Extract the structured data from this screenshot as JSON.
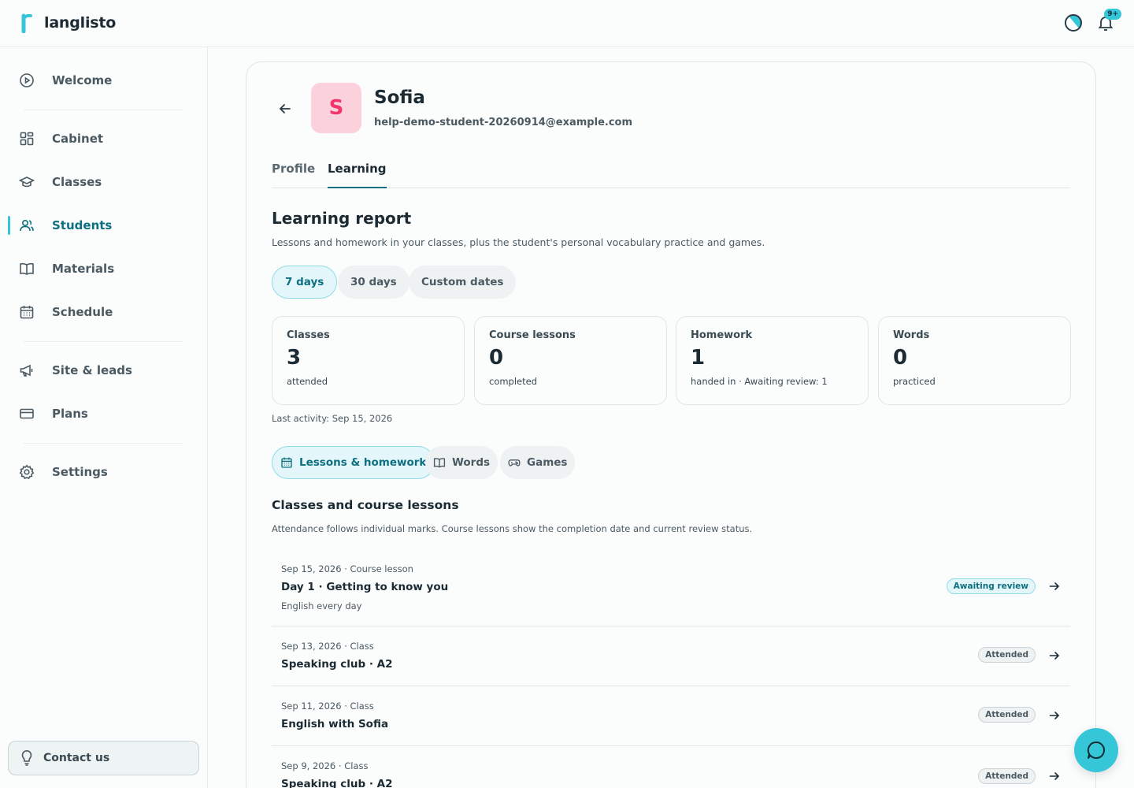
{
  "app": {
    "name": "langlisto",
    "notifications_badge": "9+"
  },
  "sidebar": {
    "items": [
      {
        "label": "Welcome"
      },
      {
        "label": "Cabinet"
      },
      {
        "label": "Classes"
      },
      {
        "label": "Students"
      },
      {
        "label": "Materials"
      },
      {
        "label": "Schedule"
      },
      {
        "label": "Site & leads"
      },
      {
        "label": "Plans"
      },
      {
        "label": "Settings"
      }
    ],
    "contact_label": "Contact us"
  },
  "student": {
    "initial": "S",
    "name": "Sofia",
    "email": "help-demo-student-20260914@example.com"
  },
  "tabs": [
    {
      "label": "Profile"
    },
    {
      "label": "Learning"
    }
  ],
  "report": {
    "title": "Learning report",
    "subtitle": "Lessons and homework in your classes, plus the student's personal vocabulary practice and games.",
    "ranges": [
      {
        "label": "7 days"
      },
      {
        "label": "30 days"
      },
      {
        "label": "Custom dates"
      }
    ],
    "stats": [
      {
        "label": "Classes",
        "value": "3",
        "note": "attended"
      },
      {
        "label": "Course lessons",
        "value": "0",
        "note": "completed"
      },
      {
        "label": "Homework",
        "value": "1",
        "note": "handed in · Awaiting review: 1"
      },
      {
        "label": "Words",
        "value": "0",
        "note": "practiced"
      }
    ],
    "last_activity": "Last activity: Sep 15, 2026"
  },
  "sections": [
    {
      "label": "Lessons & homework"
    },
    {
      "label": "Words"
    },
    {
      "label": "Games"
    }
  ],
  "lessons": {
    "title": "Classes and course lessons",
    "description": "Attendance follows individual marks. Course lessons show the completion date and current review status.",
    "rows": [
      {
        "meta": "Sep 15, 2026 · Course lesson",
        "title": "Day 1 · Getting to know you",
        "extra": "English every day",
        "status": "Awaiting review"
      },
      {
        "meta": "Sep 13, 2026 · Class",
        "title": "Speaking club · A2",
        "status": "Attended"
      },
      {
        "meta": "Sep 11, 2026 · Class",
        "title": "English with Sofia",
        "status": "Attended"
      },
      {
        "meta": "Sep 9, 2026 · Class",
        "title": "Speaking club · A2",
        "status": "Attended"
      }
    ]
  },
  "colors": {
    "accent": "#35c6d8",
    "accent_dark": "#0e6f80",
    "avatar_bg": "#fbd1dc",
    "avatar_fg": "#f2366b"
  }
}
